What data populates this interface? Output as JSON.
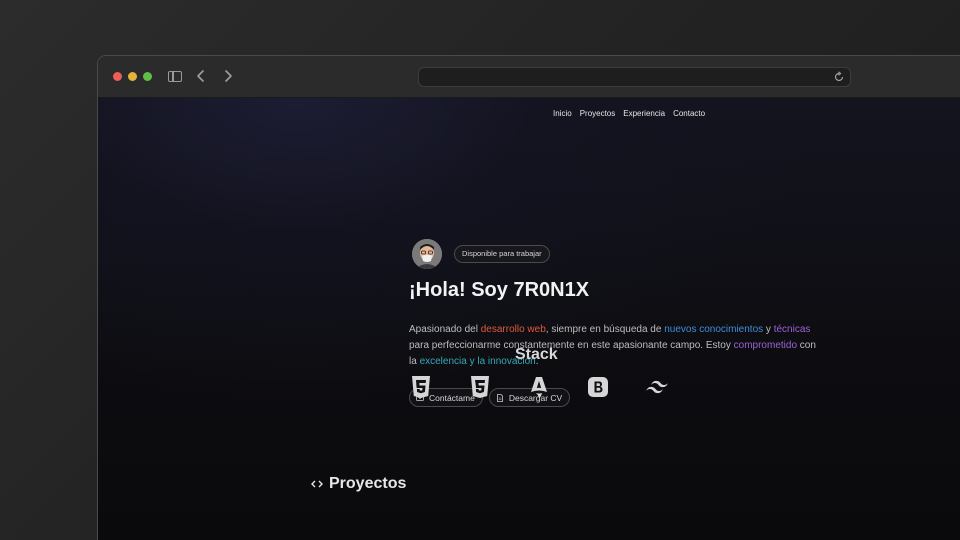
{
  "nav": {
    "items": [
      "Inicio",
      "Proyectos",
      "Experiencia",
      "Contacto"
    ]
  },
  "hero": {
    "badge": "Disponible para trabajar",
    "title": "¡Hola! Soy 7R0N1X",
    "desc": {
      "p1": "Apasionado del ",
      "h1": "desarrollo web",
      "p2": ", siempre en búsqueda de ",
      "h2": "nuevos conocimientos",
      "p3": " y ",
      "h3": "técnicas",
      "p4": " para perfeccionarme constantemente en este apasionante campo. Estoy ",
      "h4": "comprometido",
      "p5": " con la ",
      "h5": "excelencia y la innovación",
      "p6": "."
    },
    "buttons": {
      "contact": "Contáctame",
      "cv": "Descargar CV"
    }
  },
  "stack": {
    "title": "Stack",
    "icons": [
      "html5-icon",
      "css3-icon",
      "astro-icon",
      "bootstrap-icon",
      "tailwind-icon"
    ]
  },
  "projects": {
    "title": "Proyectos"
  },
  "colors": {
    "red": "#e05a3c",
    "blue": "#3f8ed8",
    "purple": "#9a62d6",
    "teal": "#37a9b7"
  }
}
